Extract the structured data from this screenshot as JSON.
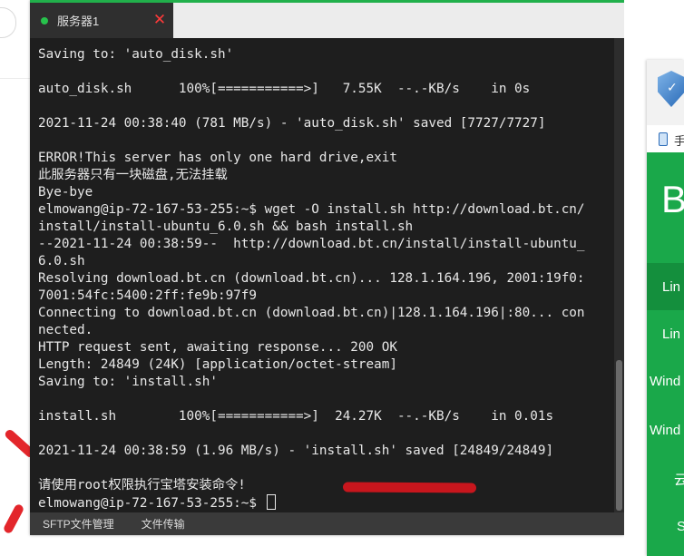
{
  "terminal": {
    "tab_title": "服务器1",
    "close_glyph": "✕",
    "lines": [
      "Saving to: 'auto_disk.sh'",
      "",
      "auto_disk.sh      100%[===========>]   7.55K  --.-KB/s    in 0s",
      "",
      "2021-11-24 00:38:40 (781 MB/s) - 'auto_disk.sh' saved [7727/7727]",
      "",
      "ERROR!This server has only one hard drive,exit",
      "此服务器只有一块磁盘,无法挂载",
      "Bye-bye",
      "elmowang@ip-72-167-53-255:~$ wget -O install.sh http://download.bt.cn/",
      "install/install-ubuntu_6.0.sh && bash install.sh",
      "--2021-11-24 00:38:59--  http://download.bt.cn/install/install-ubuntu_",
      "6.0.sh",
      "Resolving download.bt.cn (download.bt.cn)... 128.1.164.196, 2001:19f0:",
      "7001:54fc:5400:2ff:fe9b:97f9",
      "Connecting to download.bt.cn (download.bt.cn)|128.1.164.196|:80... con",
      "nected.",
      "HTTP request sent, awaiting response... 200 OK",
      "Length: 24849 (24K) [application/octet-stream]",
      "Saving to: 'install.sh'",
      "",
      "install.sh        100%[===========>]  24.27K  --.-KB/s    in 0.01s",
      "",
      "2021-11-24 00:38:59 (1.96 MB/s) - 'install.sh' saved [24849/24849]",
      "",
      "请使用root权限执行宝塔安装命令!"
    ],
    "prompt": "elmowang@ip-72-167-53-255:~$ "
  },
  "bottom_tabs": [
    "SFTP文件管理",
    "文件传输"
  ],
  "right_panel": {
    "phone_text": "手",
    "big_text": "B",
    "items": [
      "Lin",
      "Lin",
      "Wind",
      "Wind",
      "云",
      "S"
    ]
  },
  "colors": {
    "accent_green": "#21b04b",
    "close_red": "#ff3a3a",
    "terminal_bg": "#1e1e1e",
    "panel_green": "#1aa84a"
  }
}
